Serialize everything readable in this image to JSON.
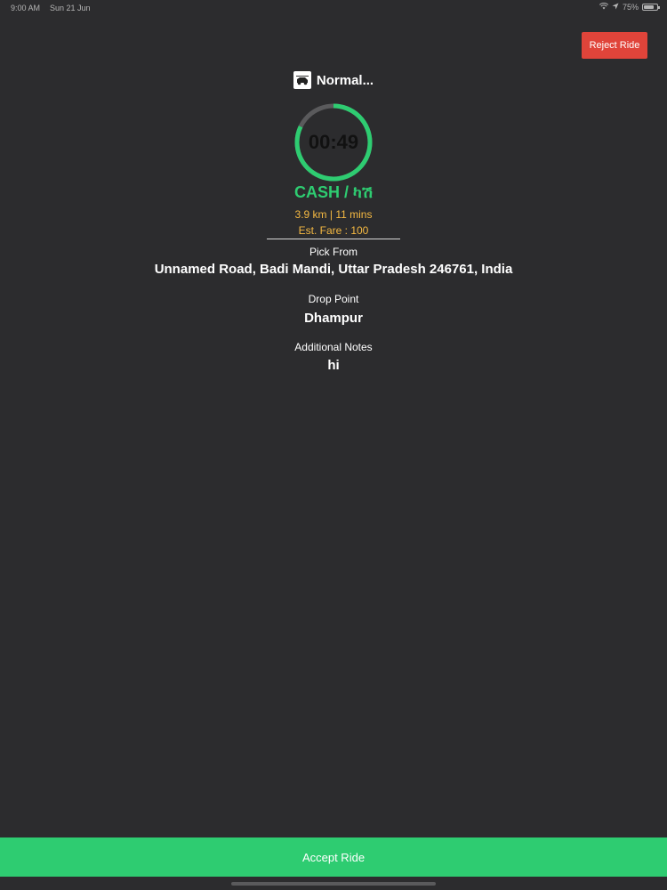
{
  "status_bar": {
    "time": "9:00 AM",
    "date": "Sun 21 Jun",
    "battery": "75%",
    "battery_level": 0.75
  },
  "header": {
    "reject_label": "Reject Ride",
    "ride_type": "Normal..."
  },
  "timer": {
    "text": "00:49",
    "progress": 0.82,
    "ring_color": "#2ecc71",
    "track_color": "#5a5a5c"
  },
  "trip": {
    "payment": "CASH / ካሽ",
    "distance_time": "3.9 km | 11 mins",
    "fare": "Est. Fare : 100"
  },
  "pickup": {
    "label": "Pick From",
    "value": "Unnamed Road, Badi Mandi, Uttar Pradesh 246761, India"
  },
  "drop": {
    "label": "Drop Point",
    "value": "Dhampur"
  },
  "notes": {
    "label": "Additional Notes",
    "value": "hi"
  },
  "footer": {
    "accept_label": "Accept Ride"
  },
  "colors": {
    "background": "#2c2c2e",
    "accent_green": "#2ecc71",
    "reject_red": "#e0443a",
    "info_orange": "#f5b942"
  }
}
